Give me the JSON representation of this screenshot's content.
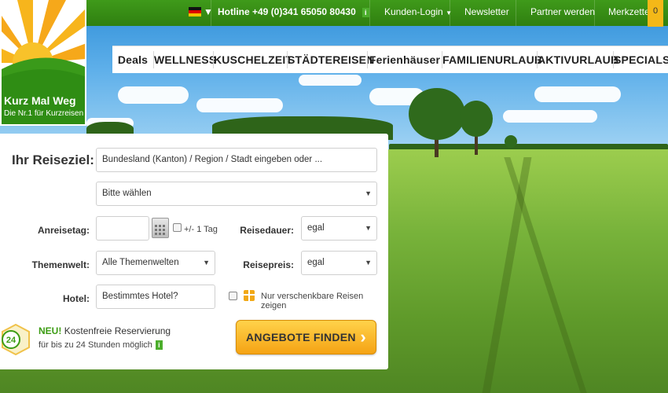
{
  "topbar": {
    "flag_icon": "german-flag-icon",
    "hotline": "Hotline +49 (0)341 65050 80430",
    "info_icon_label": "i",
    "kunden_login": "Kunden-Login",
    "newsletter": "Newsletter",
    "partner": "Partner werden",
    "merkzettel": "Merkzettel",
    "merkzettel_count": "0"
  },
  "logo": {
    "name": "Kurz Mal Weg",
    "tagline": "Die Nr.1 für Kurzreisen"
  },
  "categories": [
    "Deals",
    "WELLNESS",
    "KUSCHELZEIT",
    "STÄDTEREISEN",
    "Ferienhäuser",
    "FAMILIENURLAUB",
    "AKTIVURLAUB",
    "SPECIALS"
  ],
  "search": {
    "title": "Ihr Reiseziel:",
    "destination_placeholder": "Bundesland (Kanton)  / Region / Stadt eingeben oder ...",
    "region_select": "Bitte wählen",
    "arrival_label": "Anreisetag:",
    "arrival_value": "",
    "flex_day_label": "+/- 1 Tag",
    "duration_label": "Reisedauer:",
    "duration_value": "egal",
    "theme_label": "Themenwelt:",
    "theme_value": "Alle Themenwelten",
    "price_label": "Reisepreis:",
    "price_value": "egal",
    "hotel_label": "Hotel:",
    "hotel_placeholder": "Bestimmtes Hotel?",
    "giftable_label": "Nur verschenkbare Reisen zeigen"
  },
  "promo": {
    "badge_text": "24",
    "new_label": "NEU!",
    "headline": "Kostenfreie Reservierung",
    "subline": "für bis zu 24 Stunden möglich",
    "info_icon_label": "i"
  },
  "cta": {
    "label": "ANGEBOTE FINDEN",
    "arrow": "›"
  },
  "colors": {
    "brand_green": "#2f8d14",
    "cta_orange": "#f5a314",
    "accent_yellow": "#f4b818"
  }
}
